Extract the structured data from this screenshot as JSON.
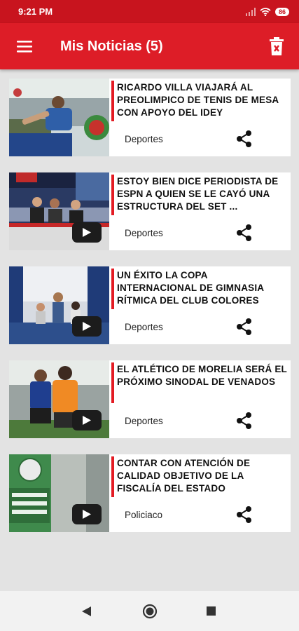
{
  "status_bar": {
    "time": "9:21 PM",
    "battery": "86"
  },
  "app_bar": {
    "title": "Mis Noticias (5)",
    "menu_icon": "hamburger-menu-icon",
    "delete_icon": "trash-icon"
  },
  "colors": {
    "primary": "#dd1d27",
    "status": "#c8141e",
    "accent_bar": "#e31b23",
    "background": "#e3e3e3"
  },
  "news": [
    {
      "headline": "RICARDO VILLA VIAJARÁ AL PREOLIMPICO DE TENIS DE MESA CON APOYO DEL IDEY",
      "category": "Deportes",
      "has_video": false
    },
    {
      "headline": "ESTOY BIEN DICE PERIODISTA DE ESPN A QUIEN SE LE CAYÓ UNA ESTRUCTURA DEL SET ...",
      "category": "Deportes",
      "has_video": true
    },
    {
      "headline": "UN ÉXITO LA COPA INTERNACIONAL DE GIMNASIA RÍTMICA DEL CLUB COLORES",
      "category": "Deportes",
      "has_video": true
    },
    {
      "headline": "EL ATLÉTICO DE MORELIA SERÁ EL PRÓXIMO SINODAL DE VENADOS",
      "category": "Deportes",
      "has_video": true
    },
    {
      "headline": "CONTAR CON ATENCIÓN DE CALIDAD OBJETIVO DE LA FISCALÍA DEL ESTADO",
      "category": "Policiaco",
      "has_video": true
    }
  ]
}
